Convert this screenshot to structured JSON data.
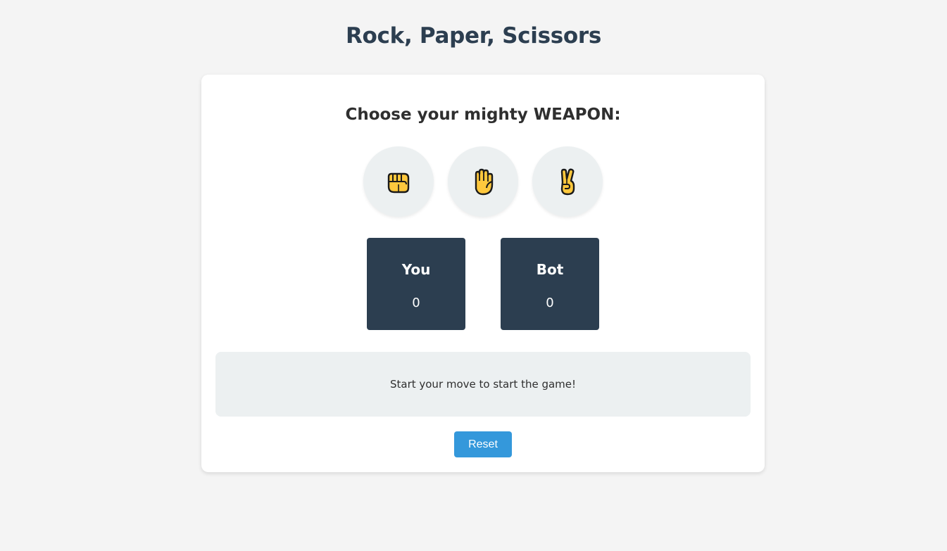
{
  "title": "Rock, Paper, Scissors",
  "prompt": "Choose your mighty WEAPON:",
  "choices": [
    {
      "id": "rock",
      "icon": "fist-icon"
    },
    {
      "id": "paper",
      "icon": "raised-hand-icon"
    },
    {
      "id": "scissors",
      "icon": "victory-hand-icon"
    }
  ],
  "scores": {
    "player": {
      "label": "You",
      "value": "0"
    },
    "bot": {
      "label": "Bot",
      "value": "0"
    }
  },
  "message": "Start your move to start the game!",
  "reset_label": "Reset",
  "colors": {
    "background": "#f4f4f4",
    "title": "#2c3e50",
    "score_box": "#2c3e50",
    "button": "#3498db",
    "panel": "#ecf0f1",
    "emoji_skin": "#ffc83d"
  }
}
